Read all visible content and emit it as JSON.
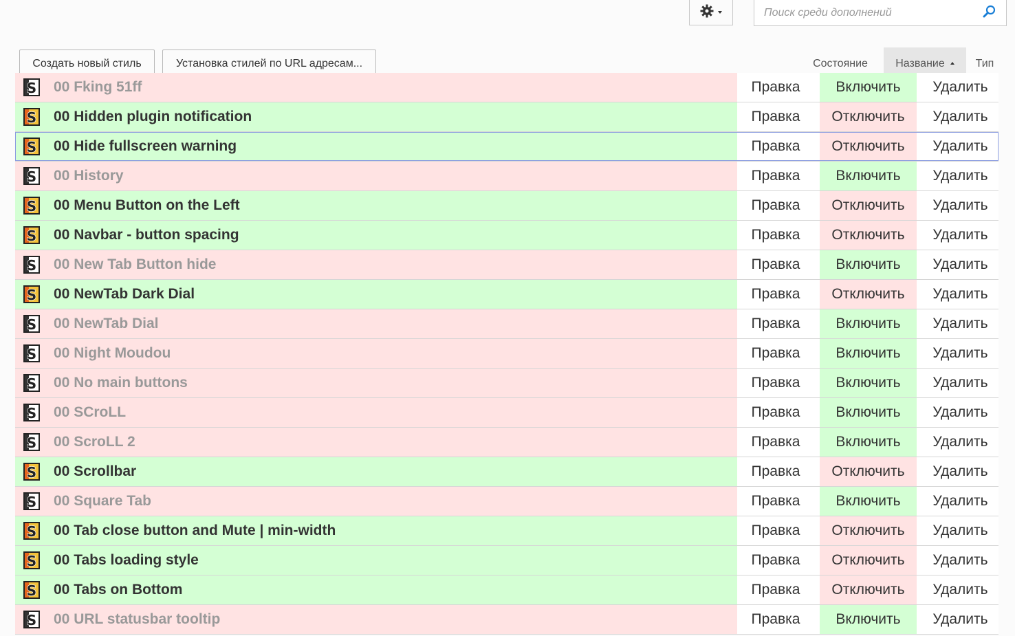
{
  "toolbar": {
    "settings_icon": "gear-icon",
    "search_placeholder": "Поиск среди дополнений",
    "search_icon": "search-icon",
    "create_style_label": "Создать новый стиль",
    "url_install_label": "Установка стилей по URL адресам..."
  },
  "sort": {
    "state_label": "Состояние",
    "name_label": "Название",
    "type_label": "Тип",
    "active": "name",
    "direction": "ascending"
  },
  "actions": {
    "edit_label": "Правка",
    "enable_label": "Включить",
    "disable_label": "Отключить",
    "remove_label": "Удалить"
  },
  "colors": {
    "enabled_bg": "#d4ffd4",
    "disabled_bg": "#ffe3e3",
    "accent": "#f39316"
  },
  "styles": [
    {
      "name": "00 Fking 51ff",
      "enabled": false,
      "toggle": "Включить"
    },
    {
      "name": "00 Hidden plugin notification",
      "enabled": true,
      "toggle": "Отключить"
    },
    {
      "name": "00 Hide fullscreen warning",
      "enabled": true,
      "toggle": "Отключить",
      "focused": true
    },
    {
      "name": "00 History",
      "enabled": false,
      "toggle": "Включить"
    },
    {
      "name": "00 Menu Button on the Left",
      "enabled": true,
      "toggle": "Отключить"
    },
    {
      "name": "00 Navbar - button spacing",
      "enabled": true,
      "toggle": "Отключить"
    },
    {
      "name": "00 New Tab Button hide",
      "enabled": false,
      "toggle": "Включить"
    },
    {
      "name": "00 NewTab Dark Dial",
      "enabled": true,
      "toggle": "Отключить"
    },
    {
      "name": "00 NewTab Dial",
      "enabled": false,
      "toggle": "Включить"
    },
    {
      "name": "00 Night Moudou",
      "enabled": false,
      "toggle": "Включить"
    },
    {
      "name": "00 No main buttons",
      "enabled": false,
      "toggle": "Включить"
    },
    {
      "name": "00 SCroLL",
      "enabled": false,
      "toggle": "Включить"
    },
    {
      "name": "00 ScroLL 2",
      "enabled": false,
      "toggle": "Включить"
    },
    {
      "name": "00 Scrollbar",
      "enabled": true,
      "toggle": "Отключить"
    },
    {
      "name": "00 Square Tab",
      "enabled": false,
      "toggle": "Включить"
    },
    {
      "name": "00 Tab close button and Mute | min-width",
      "enabled": true,
      "toggle": "Отключить"
    },
    {
      "name": "00 Tabs loading style",
      "enabled": true,
      "toggle": "Отключить"
    },
    {
      "name": "00 Tabs on Bottom",
      "enabled": true,
      "toggle": "Отключить"
    },
    {
      "name": "00 URL statusbar tooltip",
      "enabled": false,
      "toggle": "Включить"
    }
  ]
}
